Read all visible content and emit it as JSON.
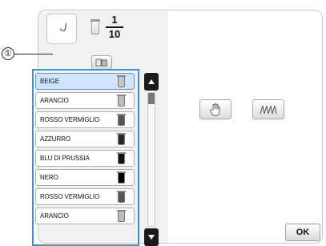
{
  "header": {
    "thread_count": {
      "current": "1",
      "total": "10"
    }
  },
  "callout": {
    "number": "①"
  },
  "thread_list": {
    "items": [
      {
        "label": "BEIGE",
        "swatch_color": "#c7c7c7",
        "selected": true
      },
      {
        "label": "ARANCIO",
        "swatch_color": "#bdbdbd",
        "selected": false
      },
      {
        "label": "ROSSO VERMIGLIO",
        "swatch_color": "#555555",
        "selected": false
      },
      {
        "label": "AZZURRO",
        "swatch_color": "#2a2a2a",
        "selected": false
      },
      {
        "label": "BLU DI PRUSSIA",
        "swatch_color": "#111111",
        "selected": false
      },
      {
        "label": "NERO",
        "swatch_color": "#000000",
        "selected": false
      },
      {
        "label": "ROSSO VERMIGLIO",
        "swatch_color": "#555555",
        "selected": false
      },
      {
        "label": "ARANCIO",
        "swatch_color": "#bdbdbd",
        "selected": false
      }
    ]
  },
  "buttons": {
    "ok_label": "OK"
  },
  "colors": {
    "highlight_border": "#3d8fd6",
    "selected_bg": "#cfe5ff"
  }
}
